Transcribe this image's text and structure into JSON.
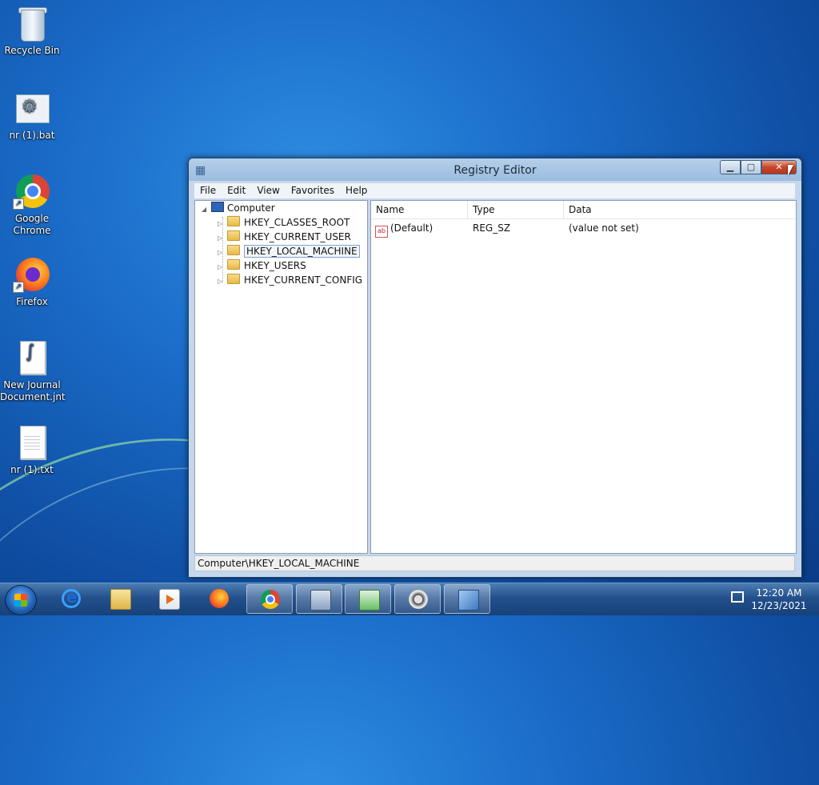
{
  "desktop": {
    "icons": [
      {
        "label": "Recycle Bin"
      },
      {
        "label": "nr (1).bat"
      },
      {
        "label": "Google Chrome"
      },
      {
        "label": "Firefox"
      },
      {
        "label": "New Journal Document.jnt"
      },
      {
        "label": "nr (1).txt"
      }
    ]
  },
  "window": {
    "title": "Registry Editor",
    "caption": {
      "minimize": "▁",
      "maximize": "▢",
      "close": "✕"
    },
    "menu": [
      "File",
      "Edit",
      "View",
      "Favorites",
      "Help"
    ],
    "tree": {
      "root": "Computer",
      "items": [
        "HKEY_CLASSES_ROOT",
        "HKEY_CURRENT_USER",
        "HKEY_LOCAL_MACHINE",
        "HKEY_USERS",
        "HKEY_CURRENT_CONFIG"
      ],
      "selected": "HKEY_LOCAL_MACHINE"
    },
    "list": {
      "columns": [
        "Name",
        "Type",
        "Data"
      ],
      "rows": [
        {
          "name": "(Default)",
          "type": "REG_SZ",
          "data": "(value not set)"
        }
      ]
    },
    "status": "Computer\\HKEY_LOCAL_MACHINE"
  },
  "taskbar": {
    "apps": [
      "internet-explorer",
      "windows-explorer",
      "media-player",
      "firefox",
      "google-chrome",
      "door-app",
      "download-app",
      "video-app",
      "registry-editor"
    ],
    "active_app": "registry-editor",
    "clock": {
      "time": "12:20 AM",
      "date": "12/23/2021"
    }
  }
}
